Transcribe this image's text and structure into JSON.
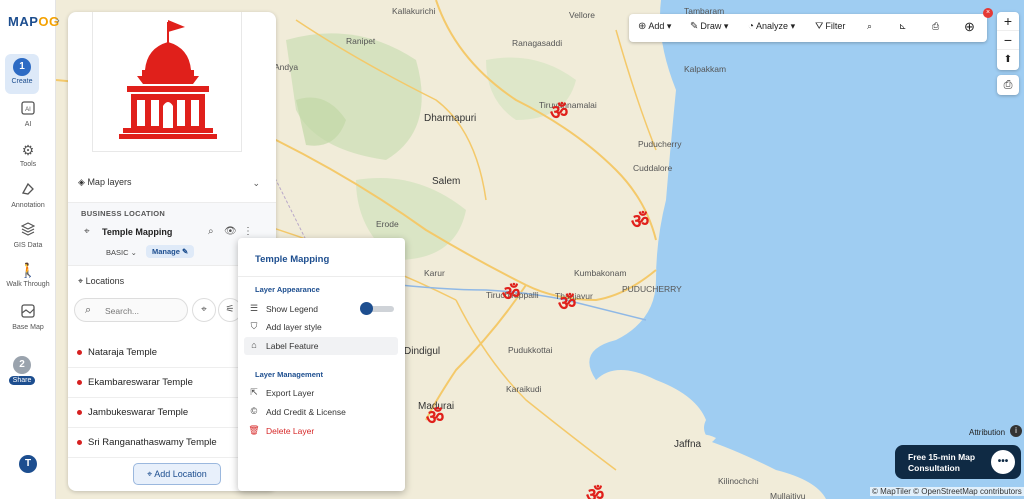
{
  "app": {
    "logo_text": "MAP",
    "logo_accent": "OG",
    "brand_color": "#1d4e8f"
  },
  "rail": {
    "step1": {
      "num": "1",
      "label": "Create"
    },
    "items": [
      {
        "icon": "ai-icon",
        "label": "AI"
      },
      {
        "icon": "tools-icon",
        "label": "Tools"
      },
      {
        "icon": "annotation-icon",
        "label": "Annotation"
      },
      {
        "icon": "gis-data-icon",
        "label": "GIS Data"
      },
      {
        "icon": "walk-through-icon",
        "label": "Walk Through"
      },
      {
        "icon": "base-map-icon",
        "label": "Base Map"
      }
    ],
    "step2": {
      "num": "2",
      "label": "Share"
    },
    "avatar": "T"
  },
  "panel": {
    "map_layers_title": "Map layers",
    "business_location": "BUSINESS LOCATION",
    "layer_name": "Temple Mapping",
    "layer_style": "BASIC",
    "manage_label": "Manage",
    "locations_title": "Locations",
    "search_placeholder": "Search...",
    "locations": [
      "Nataraja Temple",
      "Ekambareswarar Temple",
      "Jambukeswarar Temple",
      "Sri Ranganathaswamy Temple"
    ],
    "add_location": "Add Location"
  },
  "menu": {
    "title": "Temple Mapping",
    "group_appearance": "Layer Appearance",
    "show_legend": "Show Legend",
    "add_layer_style": "Add layer style",
    "label_feature": "Label Feature",
    "group_management": "Layer Management",
    "export_layer": "Export Layer",
    "add_credit": "Add Credit & License",
    "delete_layer": "Delete Layer"
  },
  "toolbar": {
    "add": "Add",
    "draw": "Draw",
    "analyze": "Analyze",
    "filter": "Filter"
  },
  "map": {
    "places": [
      {
        "name": "Vellore"
      },
      {
        "name": "Ranipet"
      },
      {
        "name": "Tambaram"
      },
      {
        "name": "Ranagasaddi"
      },
      {
        "name": "Kallakurichi"
      },
      {
        "name": "Andya"
      },
      {
        "name": "Kalpakkam"
      },
      {
        "name": "Tiruvannamalai"
      },
      {
        "name": "Dharmapuri"
      },
      {
        "name": "Puducherry"
      },
      {
        "name": "Cuddalore"
      },
      {
        "name": "Salem"
      },
      {
        "name": "Erode"
      },
      {
        "name": "Karur"
      },
      {
        "name": "Kumbakonam"
      },
      {
        "name": "Tiruchirappalli"
      },
      {
        "name": "Thanjavur"
      },
      {
        "name": "PUDUCHERRY"
      },
      {
        "name": "Dindigul"
      },
      {
        "name": "Pudukkottai"
      },
      {
        "name": "Karaikudi"
      },
      {
        "name": "Madurai"
      },
      {
        "name": "Jaffna"
      },
      {
        "name": "Kilinochchi"
      },
      {
        "name": "Mullaitivu"
      }
    ],
    "marker_symbol": "ॐ",
    "marker_color": "#e0201b",
    "attribution": "Attribution",
    "consult_text": "Free 15-min Map Consultation",
    "copyright": "© MapTiler © OpenStreetMap contributors"
  }
}
